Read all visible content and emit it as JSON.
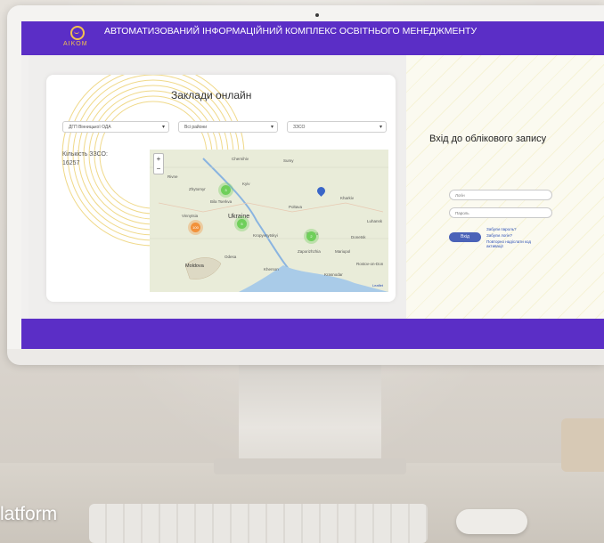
{
  "overlay": {
    "caption": "latform"
  },
  "header": {
    "logo_text": "AIKOM",
    "title": "АВТОМАТИЗОВАНИЙ ІНФОРМАЦІЙНИЙ КОМПЛЕКС ОСВІТНЬОГО МЕНЕДЖМЕНТУ",
    "color": "#5b2ec6"
  },
  "main": {
    "title": "Заклади онлайн",
    "filters": [
      {
        "value": "ДГП Вінницької ОДА"
      },
      {
        "value": "Всі райони"
      },
      {
        "value": "ЗЗСО"
      }
    ],
    "count_label": "Кількість ЗЗСО:",
    "count_value": "16257"
  },
  "map": {
    "zoom_in": "+",
    "zoom_out": "−",
    "labels": [
      "Chernihiv",
      "Rivne",
      "Zhytomyr",
      "Kyiv",
      "Bila Tserkva",
      "Poltava",
      "Ukraine",
      "Vinnytsia",
      "Kharkiv",
      "Dnipro",
      "Kropyvnytskyi",
      "Zaporizhzhia",
      "Odesa",
      "Moldova",
      "Kherson",
      "Luhansk",
      "Donetsk",
      "Mariupol",
      "Sumy",
      "Rostov-on-Don",
      "Krasnodar",
      "Leaflet"
    ],
    "clusters": [
      {
        "count": "3",
        "color": "green"
      },
      {
        "count": "5",
        "color": "green"
      },
      {
        "count": "2",
        "color": "green"
      },
      {
        "count": "100",
        "color": "orange"
      }
    ]
  },
  "login": {
    "title": "Вхід до облікового запису",
    "login_placeholder": "Логін",
    "password_placeholder": "Пароль",
    "button": "Вхід",
    "links": [
      "Забули пароль?",
      "Забули логін?",
      "Повторно надіслати код активації"
    ]
  }
}
